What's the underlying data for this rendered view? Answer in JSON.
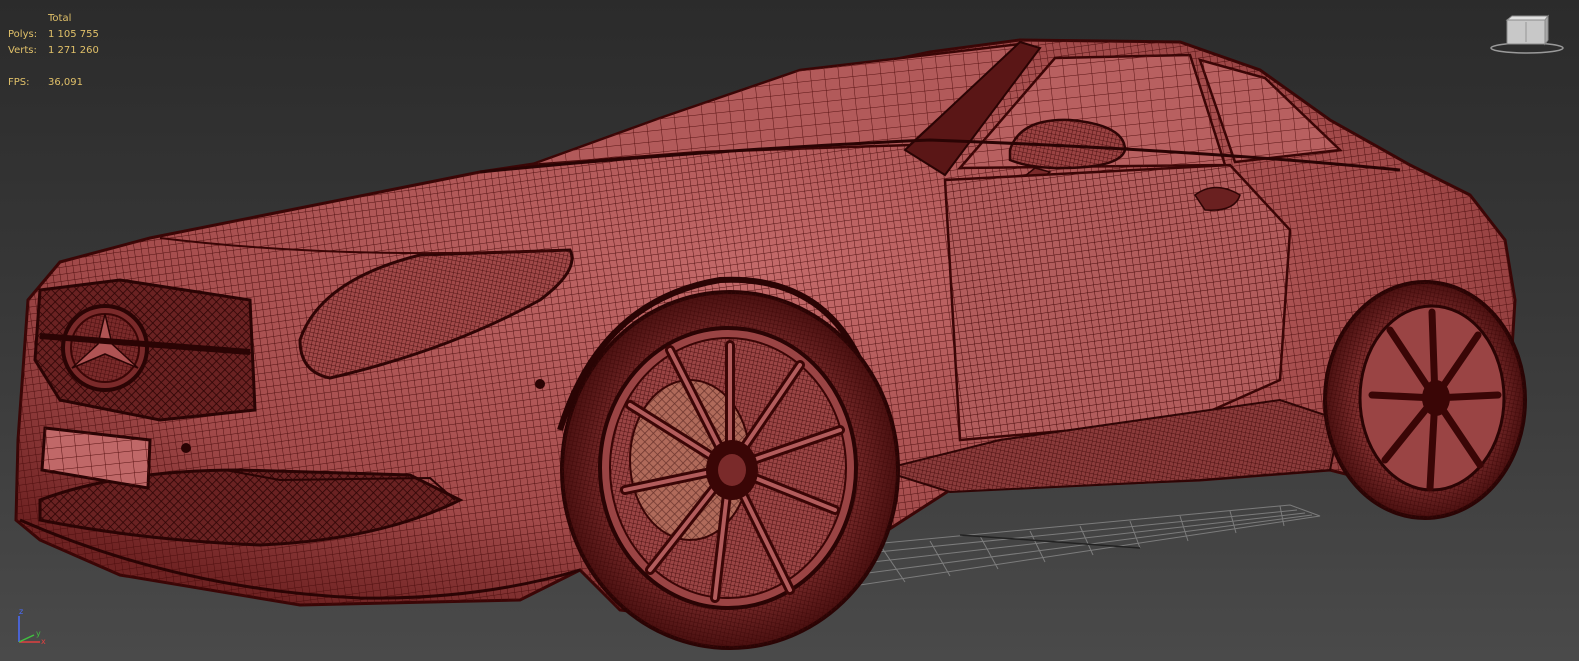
{
  "stats": {
    "header": "Total",
    "polys_label": "Polys:",
    "polys_value": "1 105 755",
    "verts_label": "Verts:",
    "verts_value": "1 271 260",
    "fps_label": "FPS:",
    "fps_value": "36,091"
  },
  "viewcube": {
    "icon": "viewcube-icon"
  },
  "axis": {
    "z_label": "z",
    "x_label": "x",
    "y_label": "y",
    "z_color": "#4a6cff",
    "x_color": "#e04040",
    "y_color": "#40c040"
  },
  "colors": {
    "mesh_fill": "#b85e5e",
    "mesh_wire": "#4a0c0c",
    "stats_text": "#e0c069",
    "background": "#3b3b3b"
  }
}
